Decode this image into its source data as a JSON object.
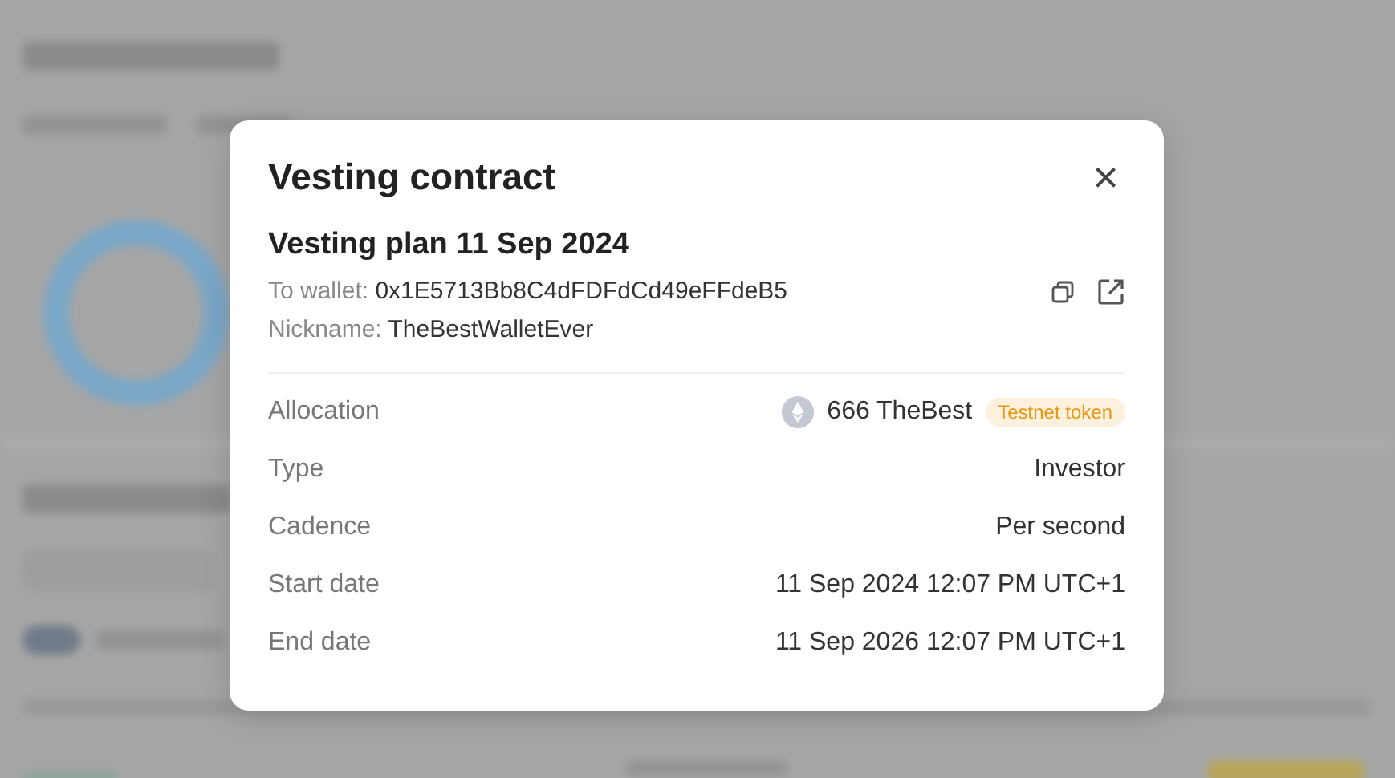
{
  "dialog": {
    "title": "Vesting contract",
    "close_icon": "×"
  },
  "plan": {
    "title": "Vesting plan 11 Sep 2024",
    "wallet_label": "To wallet:",
    "wallet": "0x1E5713Bb8C4dFDFdCd49eFFdeB5",
    "nickname_label": "Nickname:",
    "nickname": "TheBestWalletEver"
  },
  "details": [
    {
      "label": "Allocation",
      "kind": "token",
      "value": "666 TheBest",
      "badge": "Testnet token"
    },
    {
      "label": "Type",
      "kind": "text",
      "value": "Investor"
    },
    {
      "label": "Cadence",
      "kind": "text",
      "value": "Per second"
    },
    {
      "label": "Start date",
      "kind": "text",
      "value": "11 Sep 2024 12:07 PM UTC+1"
    },
    {
      "label": "End date",
      "kind": "text",
      "value": "11 Sep 2026 12:07 PM UTC+1"
    }
  ]
}
